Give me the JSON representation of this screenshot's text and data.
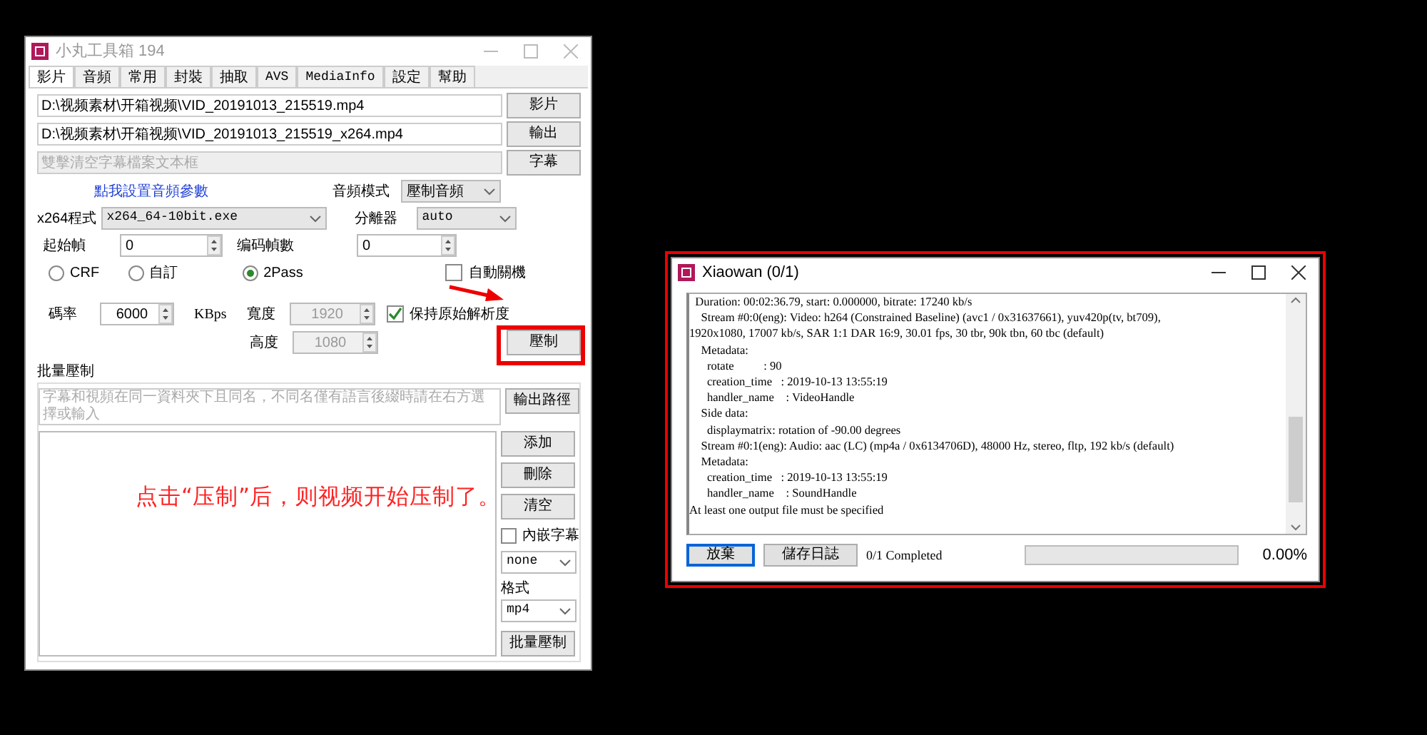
{
  "main_window": {
    "title": "小丸工具箱 194",
    "tabs": [
      {
        "label": "影片",
        "selected": true
      },
      {
        "label": "音頻",
        "selected": false
      },
      {
        "label": "常用",
        "selected": false
      },
      {
        "label": "封裝",
        "selected": false
      },
      {
        "label": "抽取",
        "selected": false
      },
      {
        "label": "AVS",
        "selected": false
      },
      {
        "label": "MediaInfo",
        "selected": false
      },
      {
        "label": "設定",
        "selected": false
      },
      {
        "label": "幫助",
        "selected": false
      }
    ],
    "files": [
      {
        "kind": "value",
        "value": "D:\\视频素材\\开箱视频\\VID_20191013_215519.mp4",
        "button": "影片"
      },
      {
        "kind": "value",
        "value": "D:\\视频素材\\开箱视频\\VID_20191013_215519_x264.mp4",
        "button": "輸出"
      },
      {
        "kind": "placeholder",
        "placeholder": "雙擊清空字幕檔案文本框",
        "button": "字幕"
      }
    ],
    "audio_link": "點我設置音頻參數",
    "audio_mode": {
      "label": "音頻模式",
      "value": "壓制音頻"
    },
    "encoder": {
      "label": "x264程式",
      "value": "x264_64-10bit.exe"
    },
    "splitter": {
      "label": "分離器",
      "value": "auto"
    },
    "start_frame": {
      "label": "起始幀",
      "value": "0"
    },
    "frame_count": {
      "label": "编码幀數",
      "value": "0"
    },
    "modes": [
      {
        "label": "CRF",
        "selected": false
      },
      {
        "label": "自訂",
        "selected": false
      },
      {
        "label": "2Pass",
        "selected": true
      }
    ],
    "auto_shutdown": {
      "label": "自動關機",
      "checked": false
    },
    "bitrate": {
      "label": "碼率",
      "value": "6000",
      "unit": "KBps"
    },
    "width": {
      "label": "寬度",
      "value": "1920",
      "disabled": true
    },
    "height": {
      "label": "高度",
      "value": "1080",
      "disabled": true
    },
    "keep_resolution": {
      "label": "保持原始解析度",
      "checked": true
    },
    "encode_button": "壓制",
    "batch": {
      "title": "批量壓制",
      "placeholder": "字幕和視頻在同一資料夾下且同名，不同名僅有語言後綴時請在右方選擇或輸入",
      "output_button": "輸出路徑",
      "buttons": [
        "添加",
        "刪除",
        "清空"
      ],
      "embed_subtitles": {
        "label": "內嵌字幕",
        "checked": false
      },
      "subtitle_select": "none",
      "format_label": "格式",
      "format_select": "mp4",
      "start_button": "批量壓制"
    }
  },
  "progress_window": {
    "title": "Xiaowan (0/1)",
    "log": [
      "  Duration: 00:02:36.79, start: 0.000000, bitrate: 17240 kb/s",
      "    Stream #0:0(eng): Video: h264 (Constrained Baseline) (avc1 / 0x31637661), yuv420p(tv, bt709),",
      "1920x1080, 17007 kb/s, SAR 1:1 DAR 16:9, 30.01 fps, 30 tbr, 90k tbn, 60 tbc (default)",
      "    Metadata:",
      "      rotate          : 90",
      "      creation_time   : 2019-10-13 13:55:19",
      "      handler_name    : VideoHandle",
      "    Side data:",
      "      displaymatrix: rotation of -90.00 degrees",
      "    Stream #0:1(eng): Audio: aac (LC) (mp4a / 0x6134706D), 48000 Hz, stereo, fltp, 192 kb/s (default)",
      "    Metadata:",
      "      creation_time   : 2019-10-13 13:55:19",
      "      handler_name    : SoundHandle",
      "At least one output file must be specified"
    ],
    "buttons": [
      {
        "label": "放棄",
        "focused": true
      },
      {
        "label": "儲存日誌",
        "focused": false
      }
    ],
    "status": "0/1 Completed",
    "progress": {
      "level": 0,
      "reading": "0.00%"
    }
  },
  "annotation": {
    "caption": "点击“压制”后，则视频开始压制了。"
  }
}
